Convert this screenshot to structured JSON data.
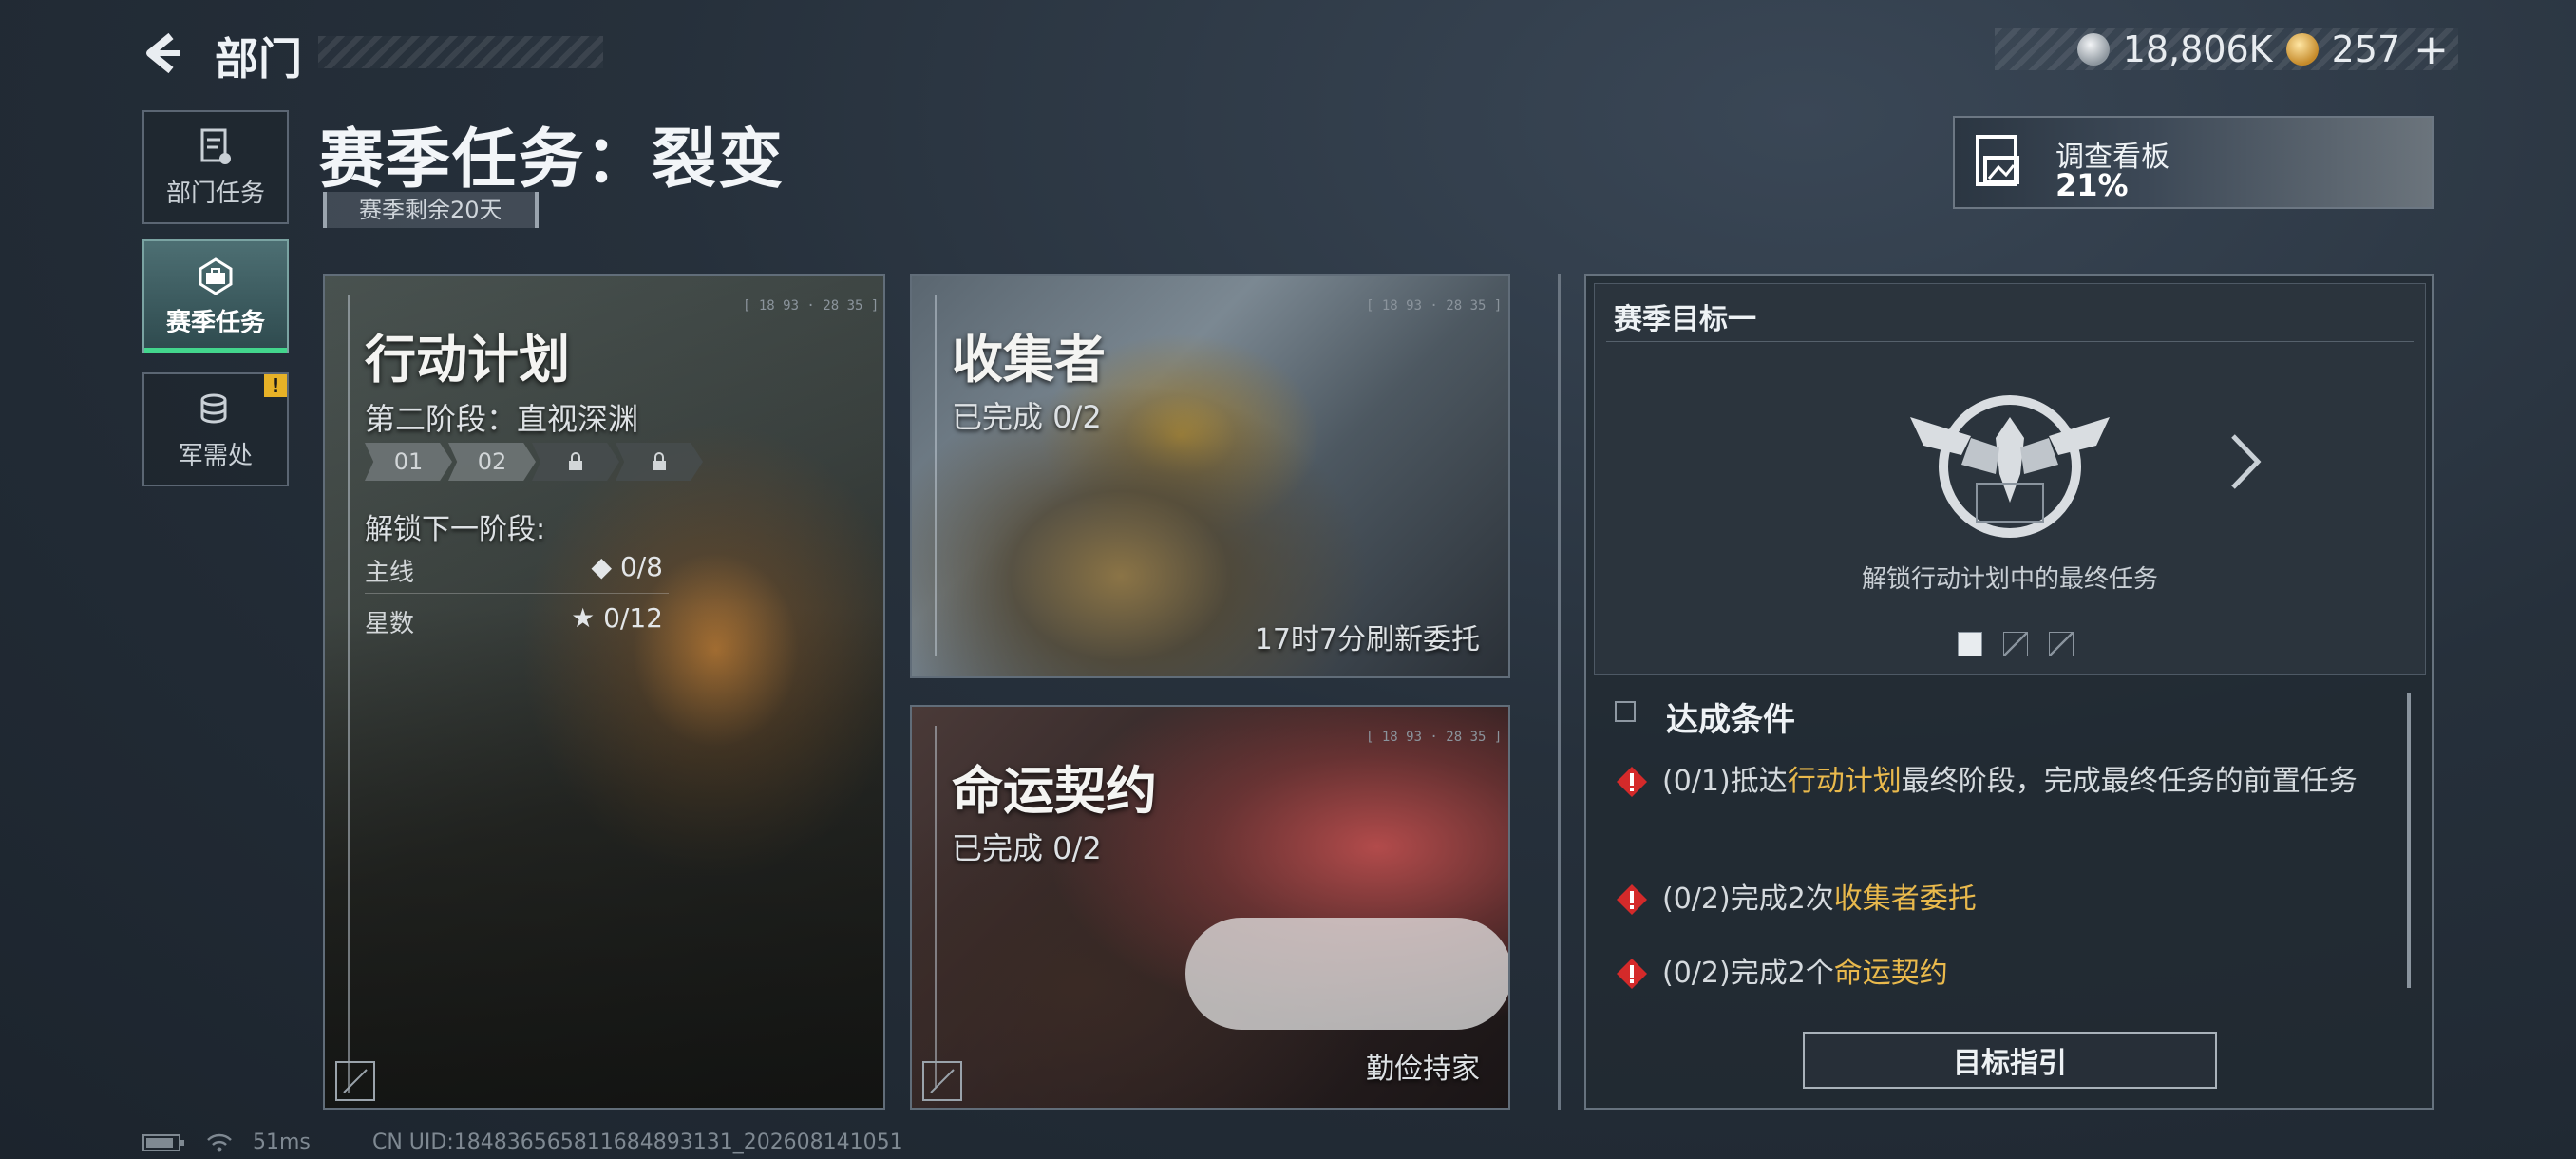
{
  "header": {
    "back_title": "部门",
    "currency": {
      "silver": "18,806K",
      "gold": "257"
    },
    "plus": "+"
  },
  "sidebar": {
    "items": [
      {
        "label": "部门任务",
        "icon": "document-icon"
      },
      {
        "label": "赛季任务",
        "icon": "briefcase-icon",
        "active": true
      },
      {
        "label": "军需处",
        "icon": "coins-icon",
        "badge": "!"
      }
    ]
  },
  "season": {
    "title": "赛季任务：裂变",
    "remaining": "赛季剩余20天"
  },
  "board": {
    "label": "调查看板",
    "percent": "21%"
  },
  "cards": {
    "action_plan": {
      "title": "行动计划",
      "stage": "第二阶段：直视深渊",
      "stages": [
        "01",
        "02"
      ],
      "unlock_label": "解锁下一阶段:",
      "main_label": "主线",
      "main_value": "0/8",
      "star_label": "星数",
      "star_value": "0/12",
      "code": "[ 18 93 · 28 35 ]"
    },
    "collector": {
      "title": "收集者",
      "progress": "已完成 0/2",
      "refresh": "17时7分刷新委托",
      "code": "[ 18 93 · 28 35 ]"
    },
    "destiny": {
      "title": "命运契约",
      "progress": "已完成 0/2",
      "label": "勤俭持家",
      "code": "[ 18 93 · 28 35 ]"
    }
  },
  "goal": {
    "title": "赛季目标一",
    "description": "解锁行动计划中的最终任务",
    "conditions_title": "达成条件",
    "conditions": [
      {
        "prefix": "(0/1)抵达",
        "highlight": "行动计划",
        "suffix": "最终阶段，完成最终任务的前置任务"
      },
      {
        "prefix": "(0/2)完成2次",
        "highlight": "收集者委托",
        "suffix": ""
      },
      {
        "prefix": "(0/2)完成2个",
        "highlight": "命运契约",
        "suffix": ""
      }
    ],
    "guide_button": "目标指引"
  },
  "footer": {
    "ping": "51ms",
    "uid": "CN UID:18483656581168489313​1_202608141051"
  },
  "colors": {
    "accent_green": "#43d68d",
    "highlight": "#e9b94c",
    "warning_red": "#d42a2a"
  }
}
